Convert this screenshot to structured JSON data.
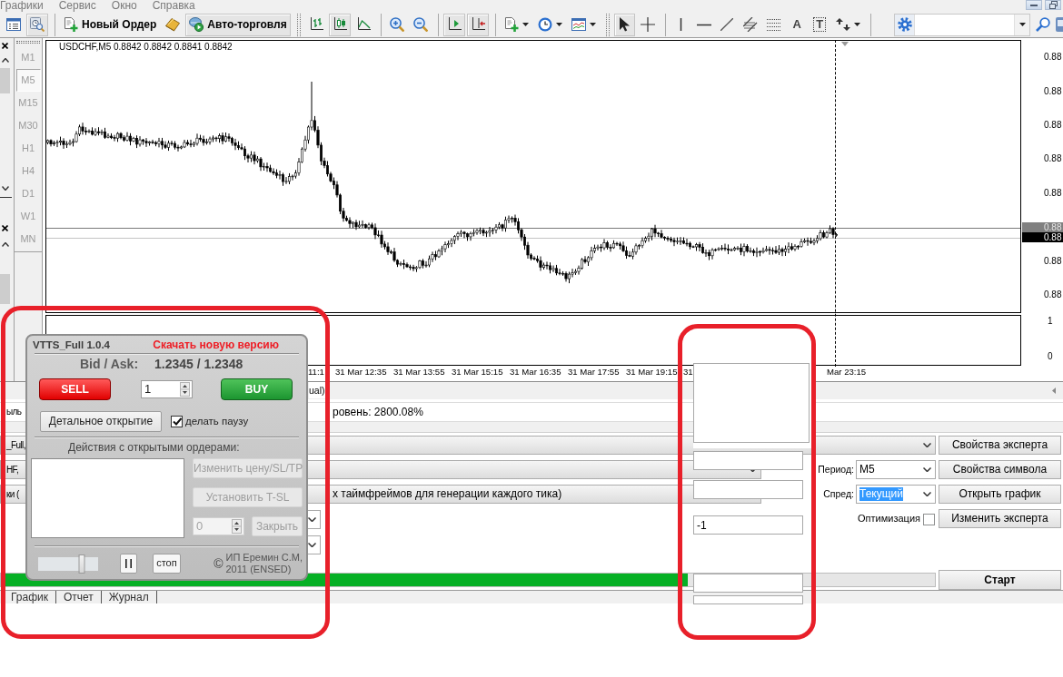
{
  "menu": [
    {
      "label": "Графики"
    },
    {
      "label": "Сервис"
    },
    {
      "label": "Окно"
    },
    {
      "label": "Справка"
    }
  ],
  "toolbar": {
    "groups": [
      {
        "grip": false,
        "items": [
          {
            "kind": "terminal",
            "pressed": false,
            "dropdown": false
          },
          {
            "kind": "navigator",
            "pressed": true,
            "dropdown": false
          }
        ]
      },
      {
        "grip": true,
        "items": [
          {
            "kind": "new-order",
            "label": "Новый Ордер",
            "pressed": false,
            "dropdown": false
          },
          {
            "kind": "history",
            "pressed": false,
            "dropdown": false
          },
          {
            "kind": "auto-trading",
            "label": "Авто-торговля",
            "pressed": true,
            "dropdown": false
          }
        ]
      },
      {
        "grip": false,
        "items": [
          {
            "kind": "bar-chart",
            "pressed": false,
            "dropdown": false
          },
          {
            "kind": "candle-chart",
            "pressed": true,
            "dropdown": false
          },
          {
            "kind": "line-chart",
            "pressed": false,
            "dropdown": false
          }
        ]
      },
      {
        "grip": false,
        "items": [
          {
            "kind": "zoom-in",
            "pressed": false,
            "dropdown": false
          },
          {
            "kind": "zoom-out",
            "pressed": false,
            "dropdown": false
          }
        ]
      },
      {
        "grip": false,
        "items": [
          {
            "kind": "chart-shift",
            "pressed": true,
            "dropdown": false
          },
          {
            "kind": "auto-scroll",
            "pressed": true,
            "dropdown": false
          }
        ]
      },
      {
        "grip": true,
        "items": [
          {
            "kind": "new-chart",
            "pressed": false,
            "dropdown": true
          },
          {
            "kind": "periods",
            "pressed": false,
            "dropdown": true
          },
          {
            "kind": "indicators",
            "pressed": false,
            "dropdown": true
          }
        ]
      },
      {
        "grip": false,
        "items": [
          {
            "kind": "cursor",
            "pressed": true,
            "dropdown": false
          },
          {
            "kind": "crosshair",
            "pressed": false,
            "dropdown": false
          }
        ]
      },
      {
        "grip": false,
        "items": [
          {
            "kind": "vertical-line",
            "pressed": false,
            "dropdown": false
          },
          {
            "kind": "horizontal-line",
            "pressed": false,
            "dropdown": false
          },
          {
            "kind": "trend-line",
            "pressed": false,
            "dropdown": false
          },
          {
            "kind": "channel",
            "pressed": false,
            "dropdown": false
          },
          {
            "kind": "fibonacci",
            "pressed": false,
            "dropdown": false
          },
          {
            "kind": "text",
            "glyph": "A",
            "pressed": false,
            "dropdown": false
          },
          {
            "kind": "label",
            "glyph": "T",
            "pressed": false,
            "dropdown": false
          },
          {
            "kind": "arrows",
            "pressed": false,
            "dropdown": true
          }
        ]
      }
    ]
  },
  "timeframes": [
    {
      "label": "M1",
      "selected": false
    },
    {
      "label": "M5",
      "selected": true
    },
    {
      "label": "M15",
      "selected": false
    },
    {
      "label": "M30",
      "selected": false
    },
    {
      "label": "H1",
      "selected": false
    },
    {
      "label": "H4",
      "selected": false
    },
    {
      "label": "D1",
      "selected": false
    },
    {
      "label": "W1",
      "selected": false
    },
    {
      "label": "MN",
      "selected": false
    }
  ],
  "chart": {
    "title": "USDCHF,M5 0.8842 0.8842 0.8841 0.8842",
    "price_ticks": [
      "0.88",
      "0.88",
      "0.88",
      "0.88",
      "0.88",
      "0.88",
      "0.88"
    ],
    "price_marks": [
      {
        "kind": "ask",
        "text": "0.88"
      },
      {
        "kind": "bid",
        "text": "0.88"
      }
    ],
    "indicator_ticks": [
      "1",
      "0"
    ],
    "time_ticks": [
      "11:1",
      "31 Mar 12:35",
      "31 Mar 13:55",
      "31 Mar 15:15",
      "31 Mar 16:35",
      "31 Mar 17:55",
      "31 Mar 19:15",
      "31",
      "Mar 23:15"
    ]
  },
  "chart_tabs": [
    {
      "label": "ual)",
      "selected": true
    }
  ],
  "tester": {
    "summary": [
      "ыль",
      "ровень: 2800.08%"
    ],
    "expert": {
      "texts": [
        "_Full,"
      ],
      "arrow": true
    },
    "symbol": {
      "texts": [
        "HF,"
      ],
      "arrow": true
    },
    "model": {
      "texts": [
        "ки (",
        "х таймфреймов для генерации каждого тика)"
      ],
      "arrow": false
    },
    "period": {
      "label": "Период:",
      "value": "M5",
      "highlighted": false
    },
    "spread": {
      "label": "Спред:",
      "value": "Текущий",
      "highlighted": true
    },
    "optimization": {
      "label": "Оптимизация",
      "checked": false
    },
    "side_buttons": [
      "Свойства эксперта",
      "Свойства символа",
      "Открыть график",
      "Изменить эксперта"
    ],
    "progress": {
      "level": 0.735
    },
    "start_button": "Старт",
    "tabs": [
      {
        "label": "График",
        "selected": false
      },
      {
        "label": "Отчет",
        "selected": false
      },
      {
        "label": "Журнал",
        "selected": false
      }
    ]
  },
  "order_panel": {
    "title": "VTTS_Full 1.0.4",
    "update_link": "Скачать новую версию",
    "bid_ask_label": "Bid / Ask:",
    "bid_ask": "1.2345 / 1.2348",
    "sell": "SELL",
    "lots": "1",
    "buy": "BUY",
    "detail_button": "Детальное открытие",
    "pause_option": {
      "label": "делать паузу",
      "checked": true
    },
    "orders_caption": "Действия с открытыми ордерами:",
    "order_buttons": [
      {
        "label": "Изменить цену/SL/TP",
        "disabled": true
      },
      {
        "label": "Установить T-SL",
        "disabled": true
      }
    ],
    "close_amount": {
      "value": "0",
      "disabled": true
    },
    "close_button": {
      "label": "Закрыть",
      "disabled": true
    },
    "speed": {
      "level": 0.72
    },
    "stop_button": "стоп",
    "copyright_sign": "©",
    "copyright": [
      "ИП Еремин С.М,",
      "2011 (ENSED)"
    ]
  },
  "overlay_fields": [
    {
      "kind": "textarea"
    },
    {
      "kind": "input"
    },
    {
      "kind": "input"
    },
    {
      "kind": "input",
      "value": "-1"
    },
    {
      "kind": "input"
    },
    {
      "kind": "input"
    }
  ]
}
